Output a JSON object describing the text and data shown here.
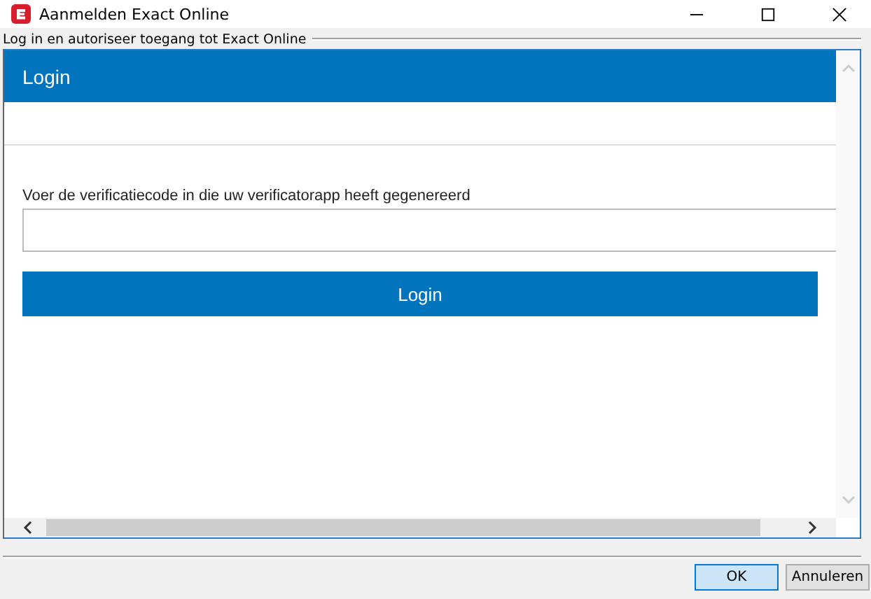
{
  "window": {
    "title": "Aanmelden Exact Online"
  },
  "group_label": "Log in en autoriseer toegang tot Exact Online",
  "page": {
    "header": "Login",
    "field_label": "Voer de verificatiecode in die uw verificatorapp heeft gegenereerd",
    "login_button": "Login"
  },
  "buttons": [
    {
      "label": "OK",
      "selected": true
    },
    {
      "label": "Annuleren",
      "selected": false
    }
  ]
}
